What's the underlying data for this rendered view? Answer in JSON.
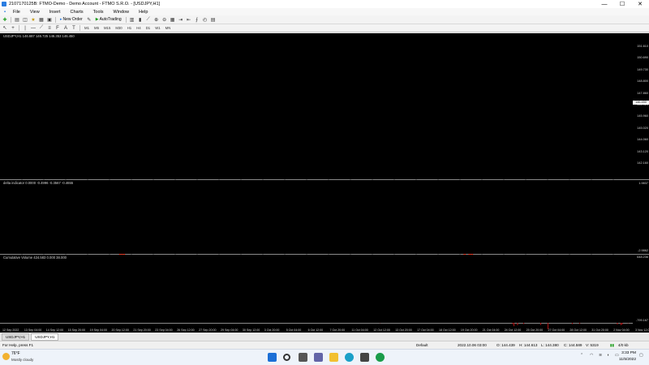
{
  "window": {
    "title": "2107170125B: FTMO-Demo - Demo Account - FTMO S.R.O. - [USDJPY,H1]",
    "minimize": "—",
    "maximize": "☐",
    "close": "✕"
  },
  "menu": [
    "File",
    "View",
    "Insert",
    "Charts",
    "Tools",
    "Window",
    "Help"
  ],
  "toolbar": {
    "new_order": "New Order",
    "autotrading": "AutoTrading",
    "timeframes": [
      "M1",
      "M5",
      "M15",
      "M30",
      "H1",
      "H4",
      "D1",
      "W1",
      "MN"
    ]
  },
  "chart": {
    "symbol_label": "USDJPY,H1  146.687 146.725 146.353 146.450",
    "price_axis": [
      "151.610",
      "150.690",
      "149.730",
      "148.800",
      "147.860",
      "146.920",
      "145.960",
      "145.020",
      "144.060",
      "143.120",
      "142.160"
    ],
    "current_price": "146.450",
    "indicator1_label": "delta indicator 0.0000 -0.4996 -0.3567 -0.4655",
    "indicator1_axis": [
      "1.9837",
      "-2.9862"
    ],
    "indicator2_label": "Cumulative Volume  424.583  0.000  38.000",
    "indicator2_axis": [
      "648.236",
      "-799.167"
    ],
    "dates": [
      "12 Sep 2022",
      "13 Sep 04:00",
      "14 Sep 12:00",
      "15 Sep 20:00",
      "19 Sep 04:00",
      "20 Sep 12:00",
      "21 Sep 20:00",
      "23 Sep 04:00",
      "26 Sep 12:00",
      "27 Sep 20:00",
      "29 Sep 04:00",
      "30 Sep 12:00",
      "3 Oct 20:00",
      "5 Oct 04:00",
      "6 Oct 12:00",
      "7 Oct 20:00",
      "11 Oct 04:00",
      "12 Oct 12:00",
      "13 Oct 20:00",
      "17 Oct 04:00",
      "18 Oct 12:00",
      "19 Oct 20:00",
      "21 Oct 04:00",
      "24 Oct 12:00",
      "25 Oct 20:00",
      "27 Oct 04:00",
      "28 Oct 12:00",
      "31 Oct 20:00",
      "2 Nov 04:00",
      "3 Nov 12:00",
      "4 Nov 20:00"
    ],
    "colors": {
      "price": "#1aa41a",
      "delta": "#ff2a10",
      "volume": "#a01010",
      "grid": "#2e2e2e"
    }
  },
  "tabs": [
    "USDJPY,H1",
    "USDJPY,H1"
  ],
  "status": {
    "help": "For Help, press F1",
    "profile": "Default",
    "datetime": "2022.10.06 03:00",
    "open": "O: 144.439",
    "high": "H: 144.613",
    "low": "L: 144.380",
    "close": "C: 144.589",
    "volume": "V: 5319",
    "traffic": "4/0 kb"
  },
  "taskbar": {
    "temperature": "76°F",
    "weather": "Mostly cloudy",
    "time": "3:33 PM",
    "date": "11/5/2022"
  }
}
